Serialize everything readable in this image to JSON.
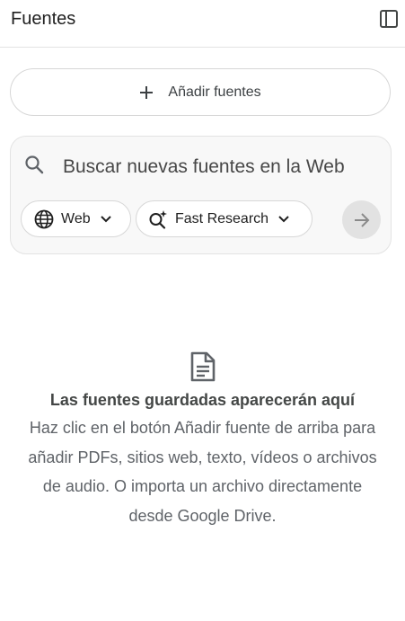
{
  "header": {
    "title": "Fuentes",
    "panel_icon": "side-panel-icon"
  },
  "add_sources": {
    "label": "Añadir fuentes",
    "icon": "plus-icon"
  },
  "search": {
    "placeholder": "Buscar nuevas fuentes en la Web",
    "icon": "search-icon"
  },
  "chips": {
    "web": {
      "label": "Web",
      "icon": "globe-icon"
    },
    "research": {
      "label": "Fast Research",
      "icon": "sparkle-search-icon"
    }
  },
  "submit": {
    "icon": "arrow-right-icon"
  },
  "empty_state": {
    "icon": "document-icon",
    "title": "Las fuentes guardadas aparecerán aquí",
    "description": "Haz clic en el botón Añadir fuente de arriba para añadir PDFs, sitios web, texto, vídeos o archivos de audio. O importa un archivo directamente desde Google Drive."
  },
  "colors": {
    "border": "#d7d7d7",
    "card_bg": "#f8f8f8",
    "submit_bg": "#e2e2e2",
    "text_muted": "#5f6368"
  }
}
